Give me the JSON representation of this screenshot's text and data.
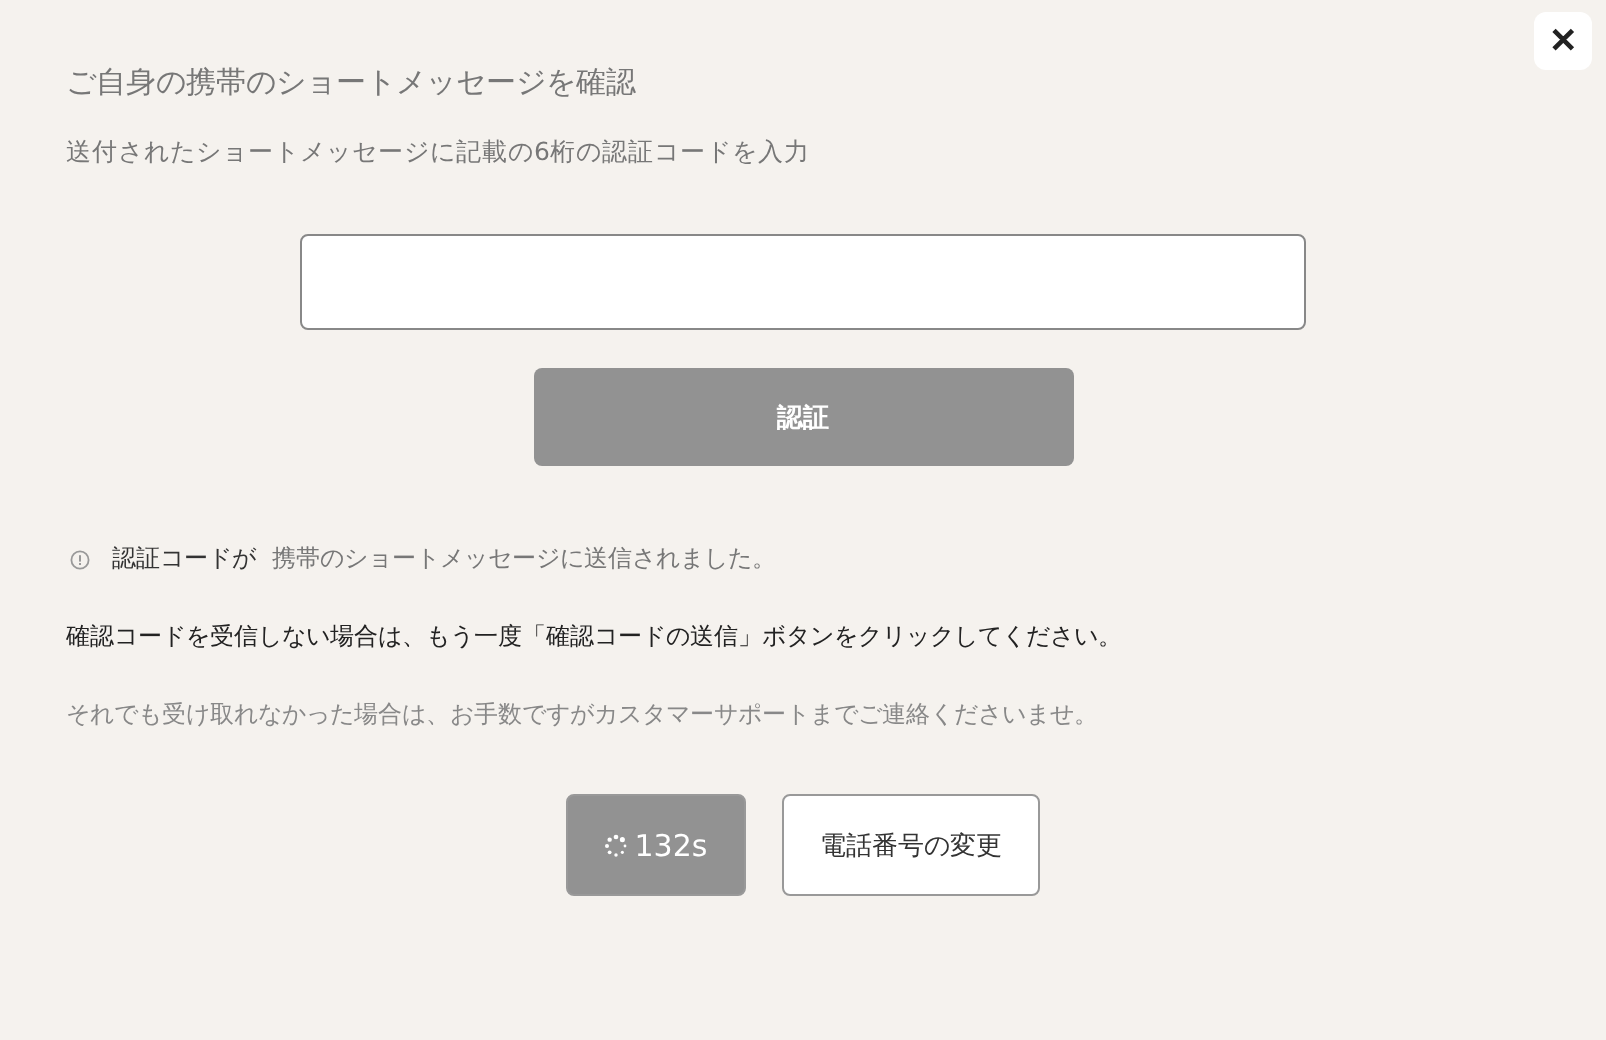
{
  "close_button": {
    "label": "✕"
  },
  "title": "ご自身の携帯のショートメッセージを確認",
  "subtitle": "送付されたショートメッセージに記載の6桁の認証コードを入力",
  "verify_button": {
    "label": "認証",
    "disabled": true
  },
  "notice": {
    "lead": "認証コードが",
    "rest": "携帯のショートメッセージに送信されました。"
  },
  "resend_hint": "確認コードを受信しない場合は、もう一度「確認コードの送信」ボタンをクリックしてください。",
  "support_hint": "それでも受け取れなかった場合は、お手数ですがカスタマーサポートまでご連絡くださいませ。",
  "buttons": [
    {
      "kind": "countdown",
      "label": "132s",
      "disabled": true
    },
    {
      "kind": "plain",
      "label": "電話番号の変更",
      "disabled": false
    }
  ]
}
